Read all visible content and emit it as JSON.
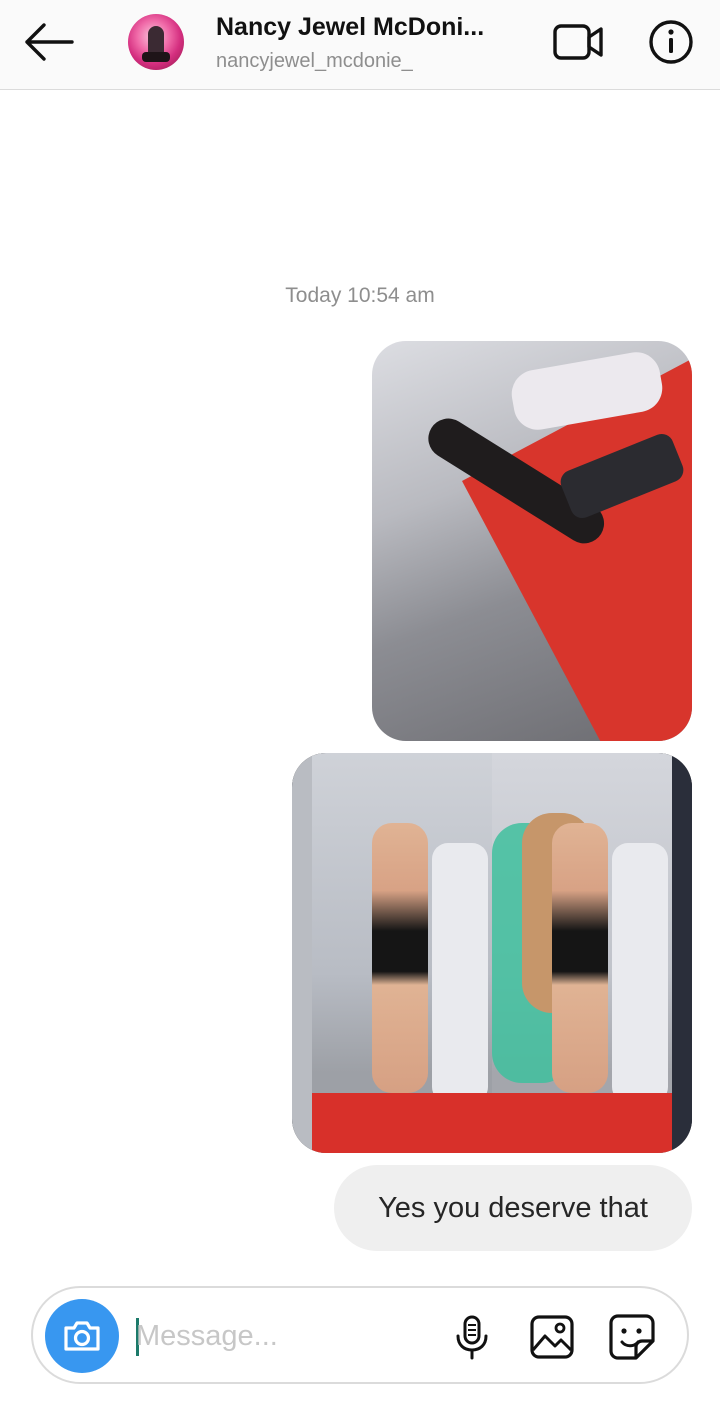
{
  "header": {
    "name": "Nancy Jewel McDoni...",
    "username": "nancyjewel_mcdonie_",
    "icons": [
      "back-arrow-icon",
      "video-call-icon",
      "info-icon"
    ]
  },
  "thread": {
    "timestamp": "Today 10:54 am",
    "messages": [
      {
        "type": "photo",
        "from": "me"
      },
      {
        "type": "photo",
        "from": "me"
      },
      {
        "type": "text",
        "from": "me",
        "text": "Yes you deserve that"
      }
    ]
  },
  "composer": {
    "placeholder": "Message...",
    "value": "",
    "icons": [
      "camera-icon",
      "microphone-icon",
      "gallery-icon",
      "sticker-icon"
    ]
  },
  "colors": {
    "accent": "#3897f0",
    "bubble": "#efefef",
    "muted_text": "#8e8e8e",
    "header_bg": "#fafafa"
  }
}
